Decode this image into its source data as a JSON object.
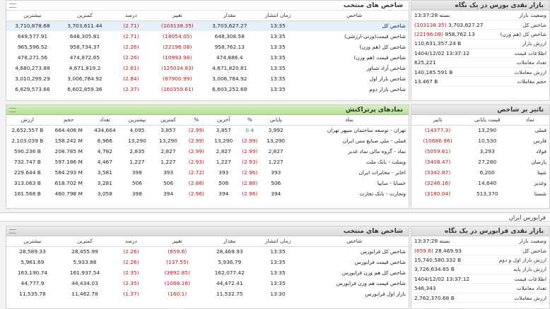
{
  "bourse_index_glance": {
    "title": "بازار نقدی بورس در یک نگاه",
    "rows": [
      {
        "k": "وضعیت بازار",
        "v": "بسته 13:37:28",
        "neg": false
      },
      {
        "k": "شاخص کل",
        "v": "3,703,627.27",
        "chg": "(103138.35)",
        "neg": true
      },
      {
        "k": "شاخص کل (هم وزن)",
        "v": "958,762.13",
        "chg": "(22196.08)",
        "neg": true
      },
      {
        "k": "ارزش بازار",
        "v": "110,631,357.24 B"
      },
      {
        "k": "اطلاعات قیمت",
        "v": "1404/12/02 13:37:12"
      },
      {
        "k": "تعداد معاملات",
        "v": "625,221"
      },
      {
        "k": "ارزش معاملات",
        "v": "140,185.591 B"
      },
      {
        "k": "حجم معاملات",
        "v": "13.467 B"
      }
    ]
  },
  "selected_indices": {
    "title": "شاخص های منتخب",
    "columns": [
      "شاخص",
      "زمان انتشار",
      "مقدار",
      "تغییر",
      "درصد",
      "کمترین",
      "بیشترین"
    ],
    "rows": [
      {
        "name": "شاخص کل",
        "time": "13:35",
        "value": "3,703,627.27",
        "change": "(103138.35)",
        "pct": "(2.71)",
        "min": "3,703,611.44",
        "max": "3,710,878.68"
      },
      {
        "name": "شاخص قیمت(وزنی-ارزشی)",
        "time": "13:35",
        "value": "648,308.58",
        "change": "(18054.05)",
        "pct": "(2.71)",
        "min": "648,305.81",
        "max": "649,577.91"
      },
      {
        "name": "شاخص کل (هم وزن)",
        "time": "13:35",
        "value": "958,762.13",
        "change": "(22196.08)",
        "pct": "(2.26)",
        "min": "958,734.37",
        "max": "965,596.52"
      },
      {
        "name": "شاخص قیمت (هم وزن)",
        "time": "13:35",
        "value": "474,886.4",
        "change": "(10993.98)",
        "pct": "(2.26)",
        "min": "474,872.65",
        "max": "478,271.56"
      },
      {
        "name": "شاخص آزاد شناور",
        "time": "13:35",
        "value": "4,671,820.81",
        "change": "(125034.83)",
        "pct": "(2.61)",
        "min": "4,671,819.2",
        "max": "4,680,273.88"
      },
      {
        "name": "شاخص بازار اول",
        "time": "13:35",
        "value": "3,006,784.92",
        "change": "(87900.99)",
        "pct": "(2.84)",
        "min": "3,006,784.92",
        "max": "3,010,299.29"
      },
      {
        "name": "شاخص بازار دوم",
        "time": "13:35",
        "value": "6,603,252.68",
        "change": "(160359.61)",
        "pct": "(2.37)",
        "min": "6,602,859.36",
        "max": "6,629,573.66"
      }
    ]
  },
  "index_impact": {
    "title": "تاثیر بر شاخص",
    "columns": [
      "نماد",
      "قیمت پایانی",
      "تاثیر"
    ],
    "rows": [
      {
        "sym": "فملی",
        "price": "13,290",
        "impact": "(14377.3)"
      },
      {
        "sym": "فارس",
        "price": "10,530",
        "impact": "(10686.96)"
      },
      {
        "sym": "فولاد",
        "price": "3,293",
        "impact": "(5059.61)"
      },
      {
        "sym": "پارسان",
        "price": "27,280",
        "impact": "(3408.47)"
      },
      {
        "sym": "شپنا",
        "price": "6,200",
        "impact": "(3342.87)"
      },
      {
        "sym": "وغدیر",
        "price": "14,640",
        "impact": "(3246.16)"
      },
      {
        "sym": "شستا",
        "price": "513,370",
        "impact": "(3180.04)"
      }
    ]
  },
  "top_symbols": {
    "title": "نمادهای پرتراکنش",
    "columns": [
      "نماد",
      "پایانی",
      "%",
      "آخرین",
      "%",
      "کمترین",
      "بیشترین",
      "تعداد",
      "حجم",
      "ارزش"
    ],
    "rows": [
      {
        "sym": "تهران - توسعه ساختمان سپهر تهران",
        "close": "3,992",
        "cpct": "0.4",
        "cpos": true,
        "last": "3,857",
        "lpct": "(2.99)",
        "min": "3,857",
        "max": "4,095",
        "count": "434,664",
        "vol": "664.406 M",
        "val": "2,652.557 B"
      },
      {
        "sym": "فملی - ملی صنایع مس ایران",
        "close": "13,290",
        "cpct": "(2.99)",
        "cpos": false,
        "last": "13,290",
        "lpct": "(2.99)",
        "min": "13,290",
        "max": "13,290",
        "count": "6,966",
        "vol": "158.242 M",
        "val": "2,103.039 B"
      },
      {
        "sym": "نماد - گروه مالی نماد غدیر",
        "close": "2,827",
        "cpct": "(2.99)",
        "cpos": false,
        "last": "2,827",
        "lpct": "(2.99)",
        "min": "2,827",
        "max": "2,835",
        "count": "4,782",
        "vol": "208.785 M",
        "val": "590.236 B"
      },
      {
        "sym": "وبملت - بانک ملت",
        "close": "1,227",
        "cpct": "(2.93)",
        "cpos": false,
        "last": "1,227",
        "lpct": "(2.93)",
        "min": "1,227",
        "max": "1,227",
        "count": "4,467",
        "vol": "597.186 M",
        "val": "732.747 B"
      },
      {
        "sym": "اخابر - مخابرات ایران",
        "close": "393",
        "cpct": "(2.96)",
        "cpos": false,
        "last": "393",
        "lpct": "(2.72)",
        "min": "393",
        "max": "398",
        "count": "3,581",
        "vol": "584.293 M",
        "val": "229.644 B"
      },
      {
        "sym": "خسایا - سایپا",
        "close": "506",
        "cpct": "(2.88)",
        "cpos": false,
        "last": "506",
        "lpct": "(2.88)",
        "min": "506",
        "max": "506",
        "count": "3,281",
        "vol": "618.702 M",
        "val": "313.063 B"
      },
      {
        "sym": "وتجارت - بانک تجارت",
        "close": "394",
        "cpct": "(2.96)",
        "cpos": false,
        "last": "394",
        "lpct": "(2.96)",
        "min": "394",
        "max": "398",
        "count": "3,058",
        "vol": "460.798 M",
        "val": "181.568 B"
      }
    ]
  },
  "farabourse_label": "فرابورس ایران",
  "fara_glance": {
    "title": "بازار نقدی فرابورس در یک نگاه",
    "rows": [
      {
        "k": "وضعیت بازار",
        "v": "بسته 13:37:28"
      },
      {
        "k": "شاخص کل",
        "v": "28,469.93",
        "chg": "(659.6)",
        "neg": true
      },
      {
        "k": "ارزش بازار اول و دوم",
        "v": "15,740,580.332 B"
      },
      {
        "k": "ارزش بازار پایه",
        "v": "3,726,634.65 B"
      },
      {
        "k": "اطلاعات قیمت",
        "v": "1404/12/02 13:37:12"
      },
      {
        "k": "تعداد معاملات",
        "v": "546,343"
      },
      {
        "k": "ارزش معاملات",
        "v": "2,762,370.68 B"
      }
    ]
  },
  "fara_indices": {
    "title": "شاخص های منتخب",
    "columns": [
      "شاخص",
      "زمان انتشار",
      "مقدار",
      "تغییر",
      "درصد",
      "کمترین",
      "بیشترین"
    ],
    "rows": [
      {
        "name": "شاخص کل فرابورس",
        "time": "13:35",
        "value": "28,469.93",
        "change": "(659.6)",
        "pct": "(2.26)",
        "min": "28,455.99",
        "max": "28,589.33"
      },
      {
        "name": "شاخص قیمت فرابورس",
        "time": "13:35",
        "value": "5,936.79",
        "change": "(137.55)",
        "pct": "(2.26)",
        "min": "5,933.88",
        "max": "5,961.69"
      },
      {
        "name": "شاخص کل هم وزن فرابورس",
        "time": "13:35",
        "value": "162,077.42",
        "change": "(3892.85)",
        "pct": "(2.35)",
        "min": "161,937.54",
        "max": "163,190.74"
      },
      {
        "name": "شاخص قیمت هم وزن فرابورس",
        "time": "13:35",
        "value": "44,472.41",
        "change": "(1068.16)",
        "pct": "(2.35)",
        "min": "44,434.03",
        "max": "44,777.9"
      },
      {
        "name": "بازار اول فرابورس",
        "time": "13:30",
        "value": "11,532.75",
        "change": "(160.1)",
        "pct": "(1.37)",
        "min": "11,462.78",
        "max": "11,535.78"
      }
    ]
  }
}
